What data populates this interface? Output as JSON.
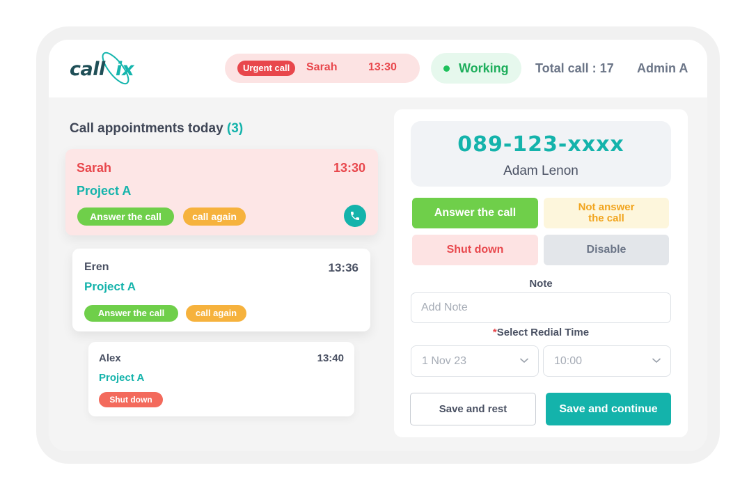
{
  "header": {
    "logo_text": "call",
    "logo_accent": "ix",
    "urgent": {
      "badge": "Urgent call",
      "name": "Sarah",
      "time": "13:30"
    },
    "status": "Working",
    "total_call": "Total call : 17",
    "user": "Admin A"
  },
  "appointments": {
    "title": "Call appointments today",
    "count": "(3)",
    "items": [
      {
        "name": "Sarah",
        "time": "13:30",
        "project": "Project A",
        "tags": [
          "Answer the call",
          "call again"
        ]
      },
      {
        "name": "Eren",
        "time": "13:36",
        "project": "Project A",
        "tags": [
          "Answer the call",
          "call again"
        ]
      },
      {
        "name": "Alex",
        "time": "13:40",
        "project": "Project A",
        "tags": [
          "Shut down"
        ]
      }
    ]
  },
  "call_panel": {
    "phone_number": "089-123-xxxx",
    "contact_name": "Adam Lenon",
    "actions": {
      "answer": "Answer the call",
      "not_answer_line1": "Not answer",
      "not_answer_line2": "the call",
      "shut_down": "Shut down",
      "disable": "Disable"
    },
    "note_label": "Note",
    "note_placeholder": "Add Note",
    "redial_required": "*",
    "redial_label": "Select Redial Time",
    "redial_date": "1 Nov 23",
    "redial_time": "10:00",
    "save_rest": "Save and rest",
    "save_continue": "Save and continue"
  },
  "colors": {
    "brand": "#14b3ab",
    "urgent": "#e8474c",
    "success": "#6fcf4a",
    "warning": "#f6b23d",
    "danger": "#f36a5c"
  },
  "icons": {
    "phone": "phone-icon",
    "dropdown": "chevron-down-icon",
    "status": "status-dot-icon"
  }
}
